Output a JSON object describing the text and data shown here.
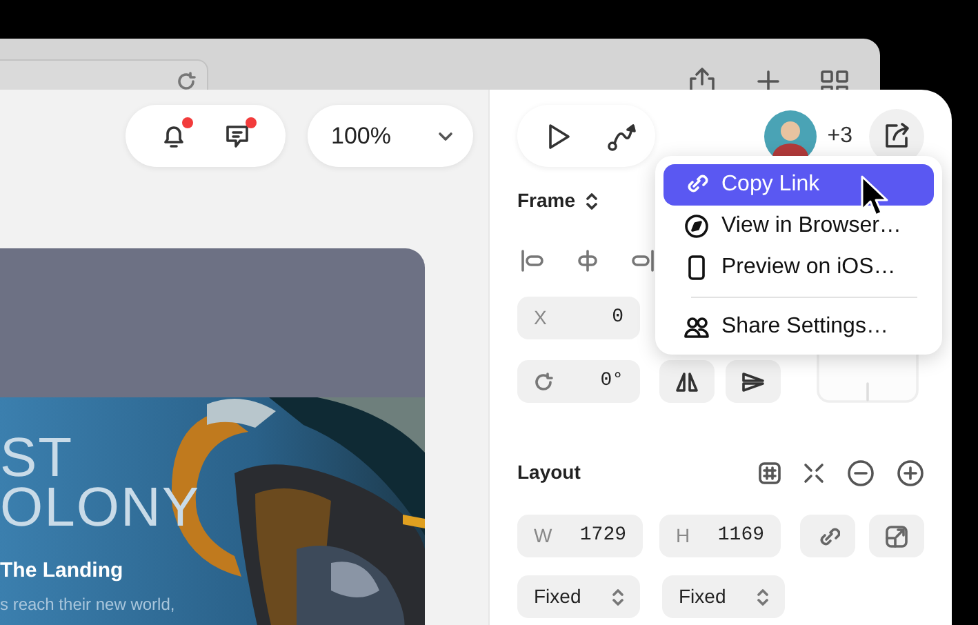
{
  "toolbar": {
    "alerts": [
      {
        "kind": "bell",
        "unread": true
      },
      {
        "kind": "comment",
        "unread": true
      }
    ],
    "zoom": "100%",
    "collaborators_extra": "+3"
  },
  "canvas_frame": {
    "title_lines": [
      "ST",
      "OLONY"
    ],
    "heading": "The Landing",
    "body": "s reach their new world,"
  },
  "share_menu": {
    "items": [
      {
        "kind": "link",
        "label": "Copy Link",
        "selected": true,
        "separator_before": false
      },
      {
        "kind": "compass",
        "label": "View in Browser…",
        "selected": false,
        "separator_before": false
      },
      {
        "kind": "phone",
        "label": "Preview on iOS…",
        "selected": false,
        "separator_before": false
      },
      {
        "kind": "people",
        "label": "Share Settings…",
        "selected": false,
        "separator_before": true
      }
    ]
  },
  "properties": {
    "frame_label": "Frame",
    "x": {
      "label": "X",
      "value": "0"
    },
    "rotation": "0°",
    "layout_label": "Layout",
    "width": {
      "label": "W",
      "value": "1729"
    },
    "height": {
      "label": "H",
      "value": "1169"
    },
    "sizing": [
      "Fixed",
      "Fixed"
    ]
  }
}
